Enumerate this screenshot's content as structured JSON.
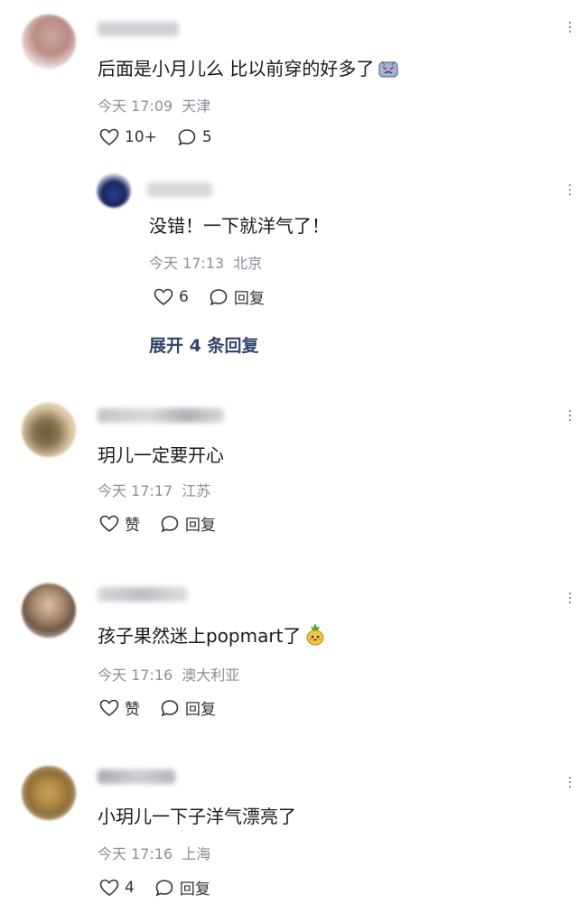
{
  "comments": [
    {
      "content": "后面是小月儿么 比以前穿的好多了",
      "emoji": "crying-face-emoji",
      "time": "今天 17:09",
      "location": "天津",
      "likes": "10+",
      "replies": "5",
      "reply": {
        "content": "没错！一下就洋气了！",
        "time": "今天 17:13",
        "location": "北京",
        "likes": "6",
        "reply_label": "回复"
      },
      "expand_label": "展开 4 条回复"
    },
    {
      "content": "玥儿一定要开心",
      "time": "今天 17:17",
      "location": "江苏",
      "likes": "赞",
      "replies": "回复"
    },
    {
      "content": "孩子果然迷上popmart了",
      "emoji": "pineapple-face-emoji",
      "time": "今天 17:16",
      "location": "澳大利亚",
      "likes": "赞",
      "replies": "回复"
    },
    {
      "content": "小玥儿一下子洋气漂亮了",
      "time": "今天 17:16",
      "location": "上海",
      "likes": "4",
      "replies": "回复"
    }
  ],
  "icons": {
    "like": "heart-outline-icon",
    "comment": "speech-bubble-icon",
    "more": "vertical-dots-icon"
  },
  "colors": {
    "text": "#1a1a1a",
    "meta": "#8a8f99",
    "expand": "#31456a"
  }
}
